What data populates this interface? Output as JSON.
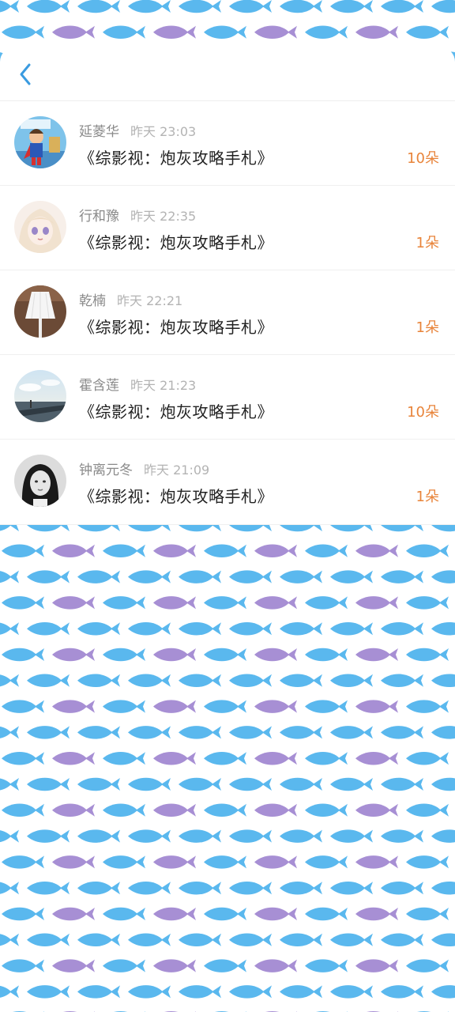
{
  "theme": {
    "fish_blue": "#5ab8ee",
    "fish_purple": "#a78fd4",
    "accent_orange": "#e8843a",
    "back_blue": "#3a9be0"
  },
  "header": {
    "back_icon": "chevron-left-icon"
  },
  "gifts": [
    {
      "user": "延菱华",
      "time": "昨天 23:03",
      "book": "《综影视：炮灰攻略手札》",
      "count": "10朵",
      "avatar": "cartoon-superhero-avatar"
    },
    {
      "user": "行和豫",
      "time": "昨天 22:35",
      "book": "《综影视：炮灰攻略手札》",
      "count": "1朵",
      "avatar": "anime-girl-avatar"
    },
    {
      "user": "乾楠",
      "time": "昨天 22:21",
      "book": "《综影视：炮灰攻略手札》",
      "count": "1朵",
      "avatar": "lamp-avatar"
    },
    {
      "user": "霍含莲",
      "time": "昨天 21:23",
      "book": "《综影视：炮灰攻略手札》",
      "count": "10朵",
      "avatar": "sky-road-avatar"
    },
    {
      "user": "钟离元冬",
      "time": "昨天 21:09",
      "book": "《综影视：炮灰攻略手札》",
      "count": "1朵",
      "avatar": "bw-portrait-avatar"
    }
  ]
}
